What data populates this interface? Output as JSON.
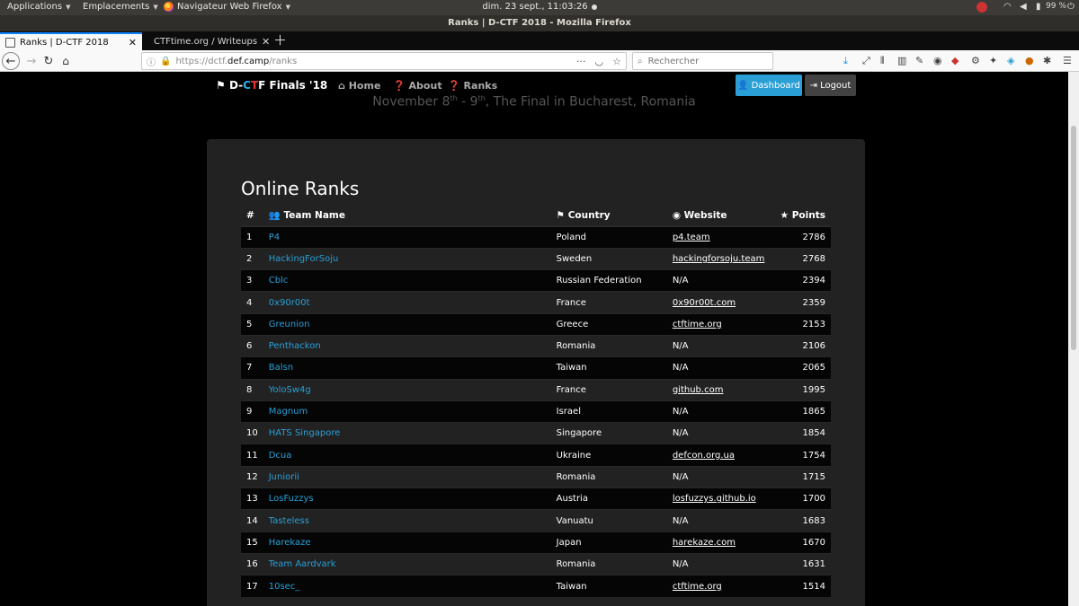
{
  "topbar": {
    "applications": "Applications",
    "places": "Emplacements",
    "browser_app": "Navigateur Web Firefox",
    "clock": "dim. 23 sept., 11:03:26",
    "battery": "99 %"
  },
  "window": {
    "title": "Ranks | D-CTF 2018 - Mozilla Firefox"
  },
  "tabs": [
    {
      "label": "Ranks | D-CTF 2018",
      "active": true
    },
    {
      "label": "CTFtime.org / Writeups",
      "active": false
    }
  ],
  "urlbar": {
    "scheme": "https://dctf.",
    "host": "def.camp",
    "path": "/ranks",
    "menu_dots": "···"
  },
  "search": {
    "placeholder": "Rechercher"
  },
  "site": {
    "brand_prefix": "D-",
    "brand_c": "C",
    "brand_t": "T",
    "brand_f": "F",
    "brand_suffix": " Finals '18",
    "nav": {
      "home": "Home",
      "about": "About",
      "ranks": "Ranks"
    },
    "dashboard": "Dashboard",
    "logout": "Logout",
    "hero_a": "November 8",
    "hero_sup1": "th",
    "hero_b": " - 9",
    "hero_sup2": "th",
    "hero_c": ", The Final in Bucharest, Romania"
  },
  "ranks": {
    "title": "Online Ranks",
    "columns": {
      "rank": "#",
      "team": "Team Name",
      "country": "Country",
      "website": "Website",
      "points": "Points"
    },
    "rows": [
      {
        "rank": "1",
        "team": "P4",
        "country": "Poland",
        "website": "p4.team",
        "linked": true,
        "points": "2786"
      },
      {
        "rank": "2",
        "team": "HackingForSoju",
        "country": "Sweden",
        "website": "hackingforsoju.team",
        "linked": true,
        "points": "2768"
      },
      {
        "rank": "3",
        "team": "Cblc",
        "country": "Russian Federation",
        "website": "N/A",
        "linked": false,
        "points": "2394"
      },
      {
        "rank": "4",
        "team": "0x90r00t",
        "country": "France",
        "website": "0x90r00t.com",
        "linked": true,
        "points": "2359"
      },
      {
        "rank": "5",
        "team": "Greunion",
        "country": "Greece",
        "website": "ctftime.org",
        "linked": true,
        "points": "2153"
      },
      {
        "rank": "6",
        "team": "Penthackon",
        "country": "Romania",
        "website": "N/A",
        "linked": false,
        "points": "2106"
      },
      {
        "rank": "7",
        "team": "Balsn",
        "country": "Taiwan",
        "website": "N/A",
        "linked": false,
        "points": "2065"
      },
      {
        "rank": "8",
        "team": "YoloSw4g",
        "country": "France",
        "website": "github.com",
        "linked": true,
        "points": "1995"
      },
      {
        "rank": "9",
        "team": "Magnum",
        "country": "Israel",
        "website": "N/A",
        "linked": false,
        "points": "1865"
      },
      {
        "rank": "10",
        "team": "HATS Singapore",
        "country": "Singapore",
        "website": "N/A",
        "linked": false,
        "points": "1854"
      },
      {
        "rank": "11",
        "team": "Dcua",
        "country": "Ukraine",
        "website": "defcon.org.ua",
        "linked": true,
        "points": "1754"
      },
      {
        "rank": "12",
        "team": "Juniorii",
        "country": "Romania",
        "website": "N/A",
        "linked": false,
        "points": "1715"
      },
      {
        "rank": "13",
        "team": "LosFuzzys",
        "country": "Austria",
        "website": "losfuzzys.github.io",
        "linked": true,
        "points": "1700"
      },
      {
        "rank": "14",
        "team": "Tasteless",
        "country": "Vanuatu",
        "website": "N/A",
        "linked": false,
        "points": "1683"
      },
      {
        "rank": "15",
        "team": "Harekaze",
        "country": "Japan",
        "website": "harekaze.com",
        "linked": true,
        "points": "1670"
      },
      {
        "rank": "16",
        "team": "Team Aardvark",
        "country": "Romania",
        "website": "N/A",
        "linked": false,
        "points": "1631"
      },
      {
        "rank": "17",
        "team": "10sec_",
        "country": "Taiwan",
        "website": "ctftime.org",
        "linked": true,
        "points": "1514"
      }
    ]
  },
  "colors": {
    "accent": "#2a9fd6",
    "panel_bg": "#222222",
    "firefox_blue": "#0a84ff"
  }
}
